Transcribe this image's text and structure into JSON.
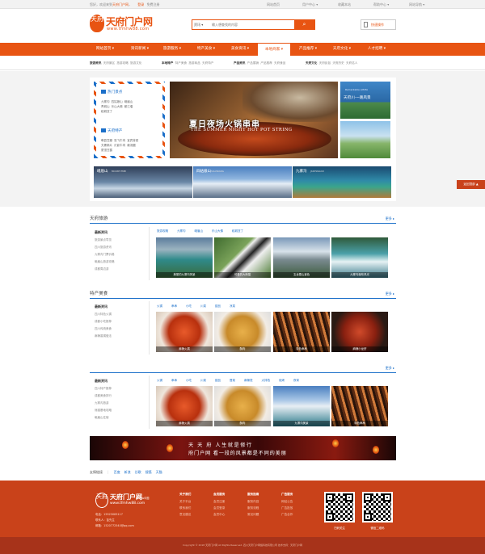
{
  "topbar": {
    "greeting_prefix": "您好，欢迎来到",
    "greeting_site": "天府门户网",
    "greeting_suffix": "，",
    "login": "登录",
    "register": "免费注册",
    "links": [
      "网站首页",
      "用户中心 ▾",
      "收藏本站",
      "帮助中心 ▾",
      "网站导航 ▾"
    ]
  },
  "header": {
    "logo_char": "天府",
    "logo_title": "天府门户网",
    "logo_url": "www.tfmhw88.com",
    "search_select": "资讯 ▾",
    "search_placeholder": "输入想查找的内容",
    "search_button_icon": "search-icon",
    "quick_label": "快速操作"
  },
  "nav": {
    "items": [
      "网站首页 ▾",
      "资讯新闻 ▾",
      "旅游服务 ▾",
      "特产美食 ▾",
      "美食资讯 ▾",
      "本地商家 ▾",
      "产品推荐 ▾",
      "天府文化 ▾",
      "人才招聘 ▾"
    ],
    "active_index": 5
  },
  "subnav": {
    "groups": [
      {
        "title": "旅游资讯",
        "items": [
          "天府景区",
          "旅游攻略",
          "旅游文化"
        ]
      },
      {
        "title": "本地特产",
        "items": [
          "特产美食",
          "旅游商品",
          "天府特产"
        ]
      },
      {
        "title": "产品资讯",
        "items": [
          "产品展销",
          "产品推荐",
          "天府食品"
        ]
      },
      {
        "title": "天府文化",
        "items": [
          "天府民俗",
          "天府历史",
          "天府名人"
        ]
      }
    ]
  },
  "slider": {
    "card": {
      "section1_title": "热门景点",
      "section1_rows": [
        "九寨沟  四姑娘山  峨眉山",
        "青城山  乐山大佛  都江堰",
        "稻城亚丁"
      ],
      "section2_title": "天府特产",
      "section2_rows": [
        "郫县豆瓣  张飞牛肉  宜宾芽菜",
        "夫妻肺片  灯影牛肉  赖汤圆",
        "蒙顶甘露"
      ]
    },
    "hero_title": "夏日夜场火锅串串",
    "hero_subtitle": "THE SUMMER NIGHT HOT POT STRING",
    "side1_title": "天府川·一路风景",
    "side1_sub": "Remarkable AISHA",
    "thumbs": [
      {
        "title": "峨眉山",
        "sub": "MOUNT EMEI"
      },
      {
        "title": "四姑娘山",
        "sub": "SIGUNIANG"
      },
      {
        "title": "九寨沟",
        "sub": "JIUZHAIGOU"
      }
    ]
  },
  "float_button": "返回顶部  ▲",
  "sections": [
    {
      "title": "天府旅游",
      "more": "更多 ▸",
      "left_title": "最新资讯",
      "left_items": [
        "旅游景点导览",
        "四川旅游资讯",
        "九寨沟门票价格",
        "峨眉山旅游攻略",
        "成都周边游"
      ],
      "tabs": [
        "旅游攻略",
        "九寨沟",
        "峨眉山",
        "乐山大佛",
        "稻城亚丁"
      ],
      "pics": [
        "美丽的九寨沟风景",
        "可爱的大熊猫",
        "玉龙雪山景色",
        "九寨沟瀑布风光"
      ]
    },
    {
      "title": "特产美食",
      "more": "更多 ▸",
      "left_title": "最新资讯",
      "left_items": [
        "四川特色火锅",
        "成都小吃推荐",
        "四川传统美食",
        "麻辣香锅做法"
      ],
      "tabs": [
        "火锅",
        "串串",
        "小吃",
        "川菜",
        "甜品",
        "凉菜"
      ],
      "pics": [
        "麻辣火锅",
        "酥肉",
        "特色串串",
        "麻辣小龙虾"
      ]
    },
    {
      "title": "",
      "more": "更多 ▸",
      "left_title": "最新资讯",
      "left_items": [
        "四川特产推荐",
        "成都美食排行",
        "九寨沟旅游",
        "熊猫基地攻略",
        "峨眉山住宿"
      ],
      "tabs": [
        "火锅",
        "串串",
        "小吃",
        "川菜",
        "甜品",
        "冒菜",
        "麻辣烫",
        "大排档",
        "烧烤",
        "夜宵"
      ],
      "pics": [
        "麻辣火锅",
        "酥肉",
        "九寨沟美景",
        "特色串串"
      ]
    }
  ],
  "banner": {
    "line1": "天 天 府  人生就是修行",
    "line2": "府门户网  看一段的风景都是不同的美丽"
  },
  "friend_links": {
    "label": "友情链接",
    "items": [
      "百度",
      "新浪",
      "谷歌",
      "搜狐",
      "天猫"
    ]
  },
  "footer": {
    "logo_char": "天府",
    "logo_title": "天府门户网",
    "logo_tag": "tfmhw中国",
    "logo_url": "www.tfmhw88.com",
    "contacts": [
      "电话：15523083117",
      "联系人：苗先生",
      "邮箱：1520772540@qq.com"
    ],
    "cols": [
      {
        "title": "关于我们",
        "items": [
          "关于平台",
          "联系我们",
          "意见建议"
        ]
      },
      {
        "title": "会员服务",
        "items": [
          "会员注册",
          "会员登录",
          "会员中心"
        ]
      },
      {
        "title": "服务指南",
        "items": [
          "服务内容",
          "服务流程",
          "常见问题"
        ]
      },
      {
        "title": "广告服务",
        "items": [
          "网站公告",
          "广告投放",
          "广告合作"
        ]
      }
    ],
    "qr_captions": [
      "扫码关注",
      "微信二维码"
    ],
    "copyright": "Copyright © 2018 天府门户网 All Rights Reserved.  四川天府门户网络科技有限公司  技术支持：天府门户网"
  },
  "colors": {
    "brand": "#e85412",
    "link": "#1b6fc9",
    "footer": "#c9421a"
  }
}
